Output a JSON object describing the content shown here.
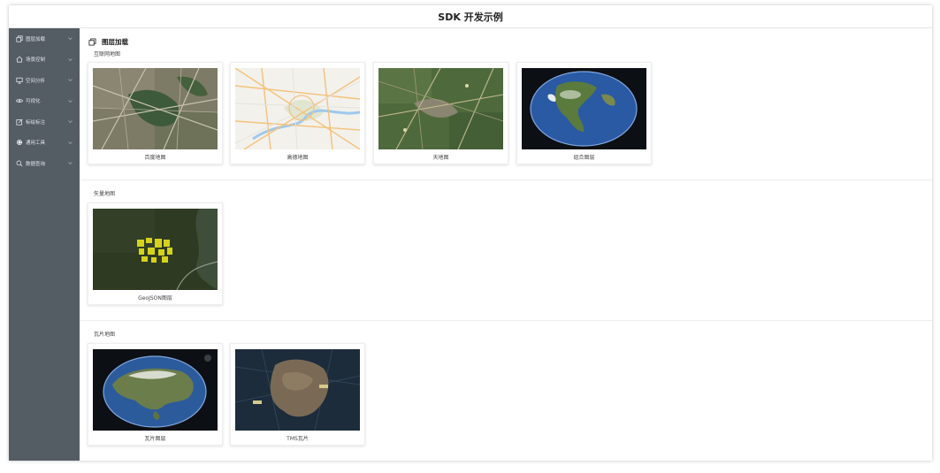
{
  "app": {
    "title": "SDK 开发示例"
  },
  "sidebar": {
    "items": [
      {
        "label": "图层加载",
        "icon": "layers-icon"
      },
      {
        "label": "场景控制",
        "icon": "home-icon"
      },
      {
        "label": "空间分析",
        "icon": "monitor-icon"
      },
      {
        "label": "可视化",
        "icon": "eye-icon"
      },
      {
        "label": "标绘标注",
        "icon": "edit-icon"
      },
      {
        "label": "通用工具",
        "icon": "gear-icon"
      },
      {
        "label": "数据查询",
        "icon": "search-icon"
      }
    ]
  },
  "main": {
    "header": {
      "title": "图层加载",
      "icon": "layers-icon"
    },
    "sections": [
      {
        "title": "互联网地图",
        "cards": [
          {
            "label": "百度地图",
            "thumb": "city-satellite"
          },
          {
            "label": "高德地图",
            "thumb": "road-map"
          },
          {
            "label": "天地图",
            "thumb": "green-satellite"
          },
          {
            "label": "组合图层",
            "thumb": "globe-america"
          }
        ]
      },
      {
        "title": "矢量地图",
        "cards": [
          {
            "label": "GeoJSON图层",
            "thumb": "geojson-yellow"
          }
        ]
      },
      {
        "title": "瓦片地图",
        "cards": [
          {
            "label": "瓦片图层",
            "thumb": "globe-asia"
          },
          {
            "label": "TMS瓦片",
            "thumb": "tms-dark"
          }
        ]
      }
    ]
  },
  "colors": {
    "sidebar_bg": "#545c64",
    "sidebar_text": "#dfe3e8",
    "card_border": "#eeeeee"
  }
}
